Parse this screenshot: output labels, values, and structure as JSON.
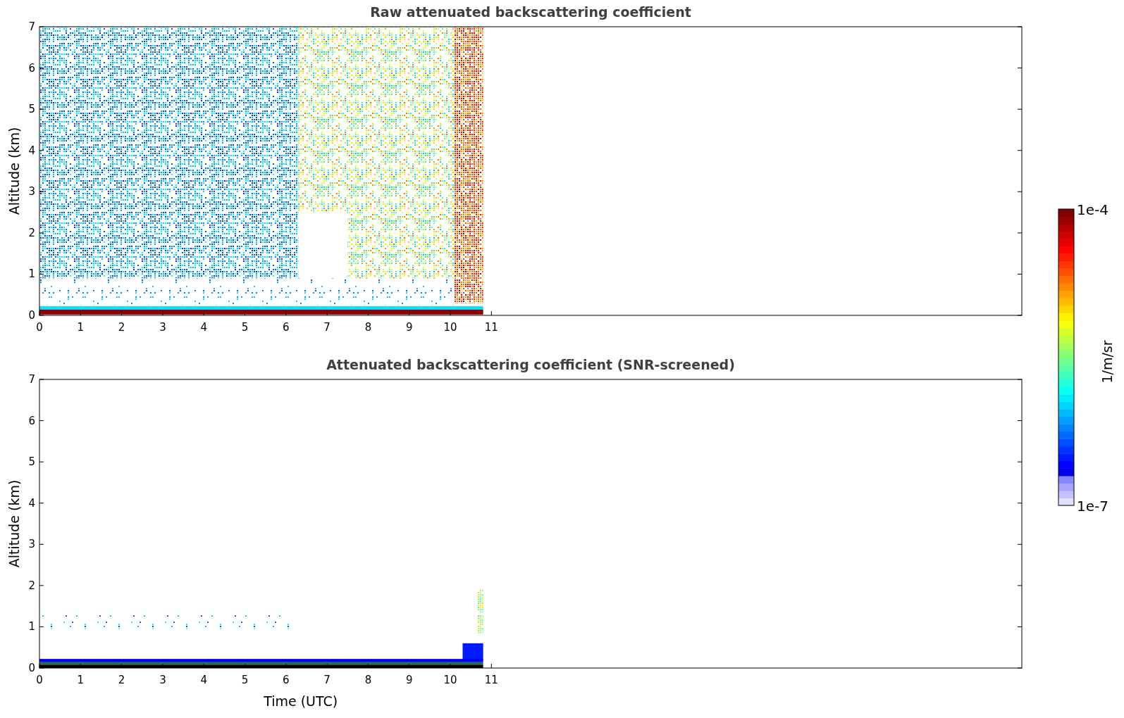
{
  "panels": [
    {
      "title": "Raw attenuated backscattering coefficient",
      "kind": "raw",
      "ylabel": "Altitude (km)",
      "yticks": [
        "7",
        "6",
        "5",
        "4",
        "3",
        "2",
        "1",
        "0"
      ],
      "xticks": [
        "0",
        "1",
        "2",
        "3",
        "4",
        "5",
        "6",
        "7",
        "8",
        "9",
        "10",
        "11"
      ]
    },
    {
      "title": "Attenuated backscattering coefficient (SNR-screened)",
      "kind": "screened",
      "ylabel": "Altitude (km)",
      "xlabel": "Time (UTC)",
      "yticks": [
        "7",
        "6",
        "5",
        "4",
        "3",
        "2",
        "1",
        "0"
      ],
      "xticks": [
        "0",
        "1",
        "2",
        "3",
        "4",
        "5",
        "6",
        "7",
        "8",
        "9",
        "10",
        "11"
      ]
    }
  ],
  "colorbar": {
    "max": "1e-4",
    "min": "1e-7",
    "label": "1/m/sr"
  }
}
